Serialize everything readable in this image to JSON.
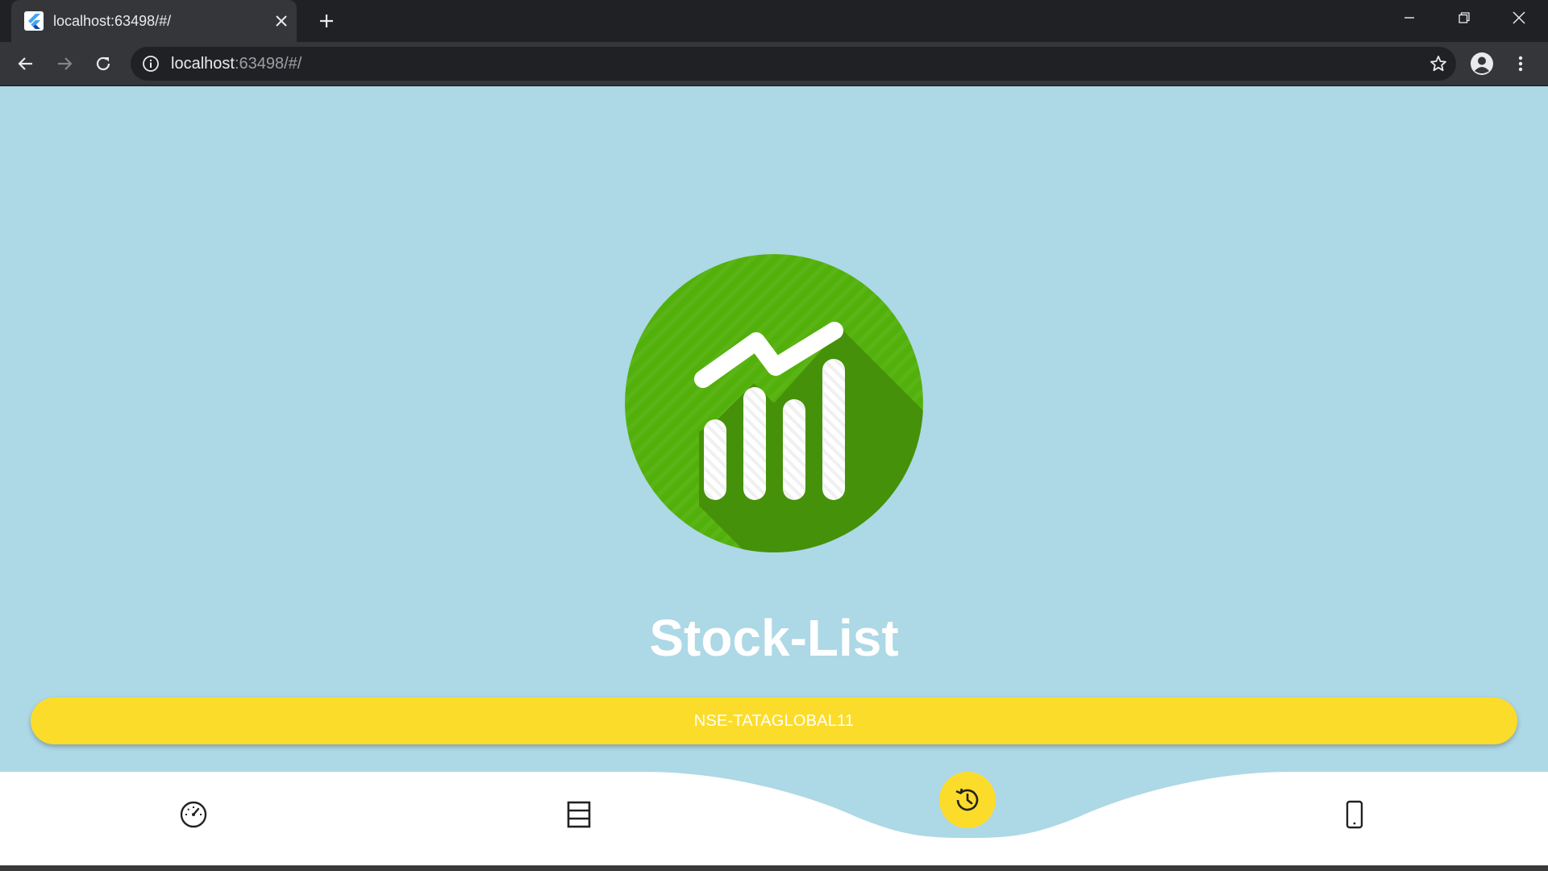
{
  "browser": {
    "tab_title": "localhost:63498/#/",
    "url_host": "localhost",
    "url_rest": ":63498/#/",
    "favicon": "flutter-icon"
  },
  "app": {
    "background_color": "#add8e6",
    "logo": "stock-chart-logo",
    "title": "Stock-List",
    "stock_button_label": "NSE-TATAGLOBAL11",
    "accent_color": "#fcdc2a",
    "logo_color": "#4caf0a"
  },
  "bottom_nav": {
    "items": [
      {
        "icon": "speedometer-icon"
      },
      {
        "icon": "list-icon"
      },
      {
        "icon": "history-icon",
        "active": true
      },
      {
        "icon": "phone-icon"
      }
    ]
  }
}
